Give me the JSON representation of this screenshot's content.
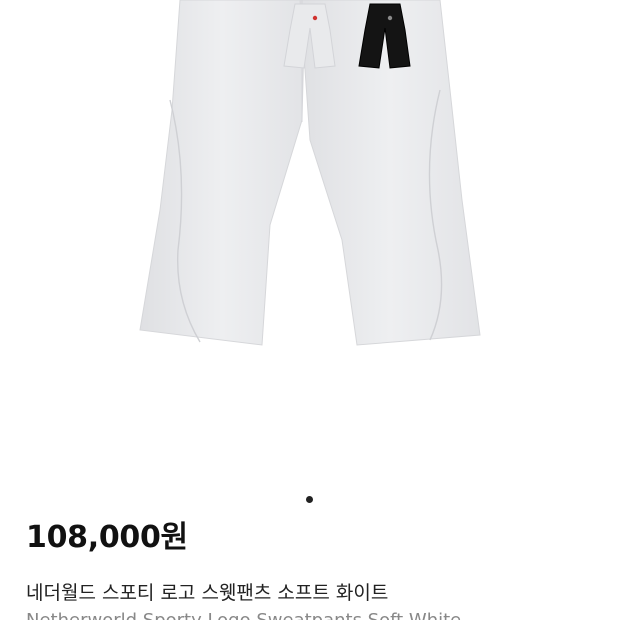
{
  "product": {
    "price": "108,000원",
    "name_ko": "네더월드 스포티 로고 스웻팬츠 소프트 화이트",
    "name_en": "Netherworld Sporty Logo Sweatpants Soft White"
  },
  "gallery": {
    "thumbnails": [
      {
        "color_name": "soft white",
        "hex": "#e9eaec"
      },
      {
        "color_name": "black",
        "hex": "#141414"
      }
    ],
    "active_index": 0
  },
  "colors": {
    "pants_main": "#eaebed",
    "pants_shade": "#dcdde0",
    "price_text": "#111111",
    "name_text": "#222222",
    "indicator_active": "#222222"
  }
}
